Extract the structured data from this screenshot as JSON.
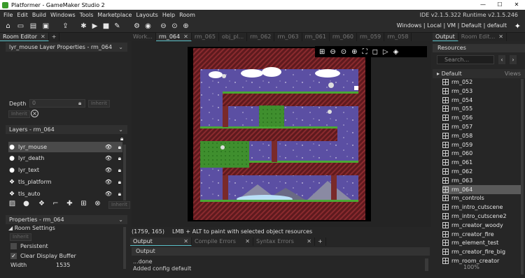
{
  "window": {
    "title": "Platformer - GameMaker Studio 2",
    "min": "—",
    "max": "☐",
    "close": "✕"
  },
  "menu": [
    "File",
    "Edit",
    "Build",
    "Windows",
    "Tools",
    "Marketplace",
    "Layouts",
    "Help",
    "Room"
  ],
  "version": "IDE v2.1.5.322 Runtime v2.1.5.246",
  "target": "Windows | Local | VM | Default | default",
  "left_panel": {
    "tab": "Room Editor",
    "layer_props_title": "lyr_mouse Layer Properties - rm_064",
    "depth_label": "Depth",
    "depth_value": "0",
    "inherit": "Inherit",
    "layers_title": "Layers - rm_064",
    "layers": [
      {
        "name": "lyr_mouse",
        "icon": "circle-icon",
        "selected": true
      },
      {
        "name": "lyr_death",
        "icon": "circle-icon",
        "selected": false
      },
      {
        "name": "lyr_text",
        "icon": "circle-icon",
        "selected": false
      },
      {
        "name": "tls_platform",
        "icon": "tiles-icon",
        "selected": false
      },
      {
        "name": "tls_auto",
        "icon": "tiles-icon",
        "selected": false
      }
    ],
    "layer_inherit": "Inherit",
    "props_title": "Properties - rm_064",
    "room_settings": "Room Settings",
    "persistent": "Persistent",
    "clear_display_buffer": "Clear Display Buffer",
    "width_label": "Width",
    "width_value": "1535"
  },
  "tabs": [
    "Work...",
    "rm_064",
    "rm_065",
    "obj_pl...",
    "rm_062",
    "rm_063",
    "rm_061",
    "rm_060",
    "rm_059",
    "rm_058"
  ],
  "active_tab": "rm_064",
  "status": {
    "coords": "(1759, 165)",
    "hint": "LMB + ALT to paint with selected object resources"
  },
  "output": {
    "tabs": [
      "Output",
      "Compile Errors",
      "Syntax Errors"
    ],
    "title": "Output",
    "lines": [
      "...done",
      "Added config default"
    ]
  },
  "right_panel": {
    "tabs": [
      "Output",
      "Room Edit..."
    ],
    "title": "Resources",
    "search_placeholder": "Search...",
    "default_label": "Default",
    "views": "Views",
    "items": [
      "rm_052",
      "rm_053",
      "rm_054",
      "rm_055",
      "rm_056",
      "rm_057",
      "rm_058",
      "rm_059",
      "rm_060",
      "rm_061",
      "rm_062",
      "rm_063",
      "rm_064",
      "rm_controls",
      "rm_intro_cutscene",
      "rm_intro_cutscene2",
      "rm_creator_woody",
      "rm_creator_fire",
      "rm_element_test",
      "rm_creator_fire_big",
      "rm_room_creator"
    ],
    "selected": "rm_064",
    "zoom": "100%"
  },
  "colors": {
    "accent": "#5bc1c9",
    "wall": "#6b1f1f",
    "sky": "#5a4ea0",
    "grass": "#3a8c2e"
  }
}
